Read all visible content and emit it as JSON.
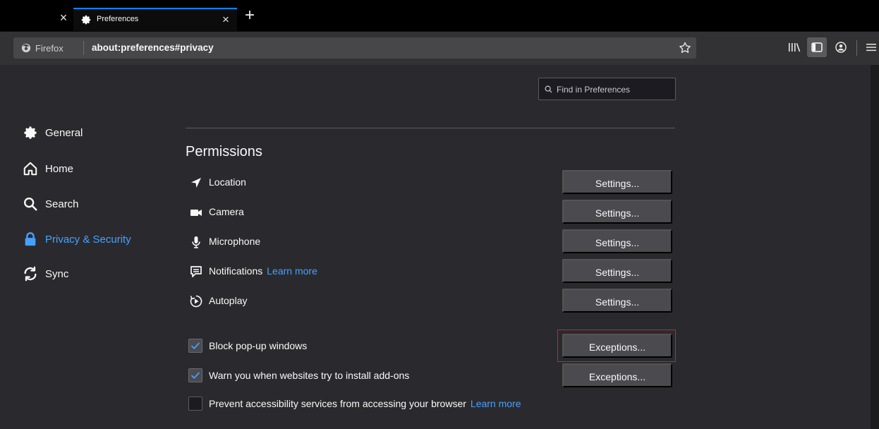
{
  "tabs": {
    "close_left_glyph": "×",
    "active": {
      "title": "Preferences",
      "icon": "gear-icon",
      "close_glyph": "×"
    },
    "new_tab_glyph": "+"
  },
  "navbar": {
    "identity_label": "Firefox",
    "url_bold": "about:preferences",
    "url_rest": "#privacy",
    "icons": [
      "star-icon",
      "library-icon",
      "sidebar-icon",
      "account-icon",
      "menu-icon"
    ]
  },
  "search": {
    "placeholder": "Find in Preferences"
  },
  "sidebar": {
    "items": [
      {
        "label": "General",
        "icon": "gear-icon"
      },
      {
        "label": "Home",
        "icon": "home-icon"
      },
      {
        "label": "Search",
        "icon": "search-icon"
      },
      {
        "label": "Privacy & Security",
        "icon": "lock-icon",
        "active": true
      },
      {
        "label": "Sync",
        "icon": "sync-icon"
      }
    ]
  },
  "permissions": {
    "title": "Permissions",
    "rows": [
      {
        "label": "Location",
        "icon": "location-icon",
        "button": "Settings..."
      },
      {
        "label": "Camera",
        "icon": "camera-icon",
        "button": "Settings..."
      },
      {
        "label": "Microphone",
        "icon": "microphone-icon",
        "button": "Settings..."
      },
      {
        "label": "Notifications",
        "learn_more": "Learn more",
        "icon": "notification-icon",
        "button": "Settings..."
      },
      {
        "label": "Autoplay",
        "icon": "autoplay-icon",
        "button": "Settings..."
      }
    ],
    "checkboxes": [
      {
        "label": "Block pop-up windows",
        "checked": true,
        "button": "Exceptions..."
      },
      {
        "label": "Warn you when websites try to install add-ons",
        "checked": true,
        "button": "Exceptions..."
      },
      {
        "label": "Prevent accessibility services from accessing your browser",
        "checked": false,
        "learn_more": "Learn more"
      }
    ]
  },
  "colors": {
    "accent": "#45a1ff",
    "tab_highlight": "#0a84ff",
    "background": "#2a2a2e",
    "button": "#4a4a4f",
    "annotation_box": "#d0202a"
  }
}
